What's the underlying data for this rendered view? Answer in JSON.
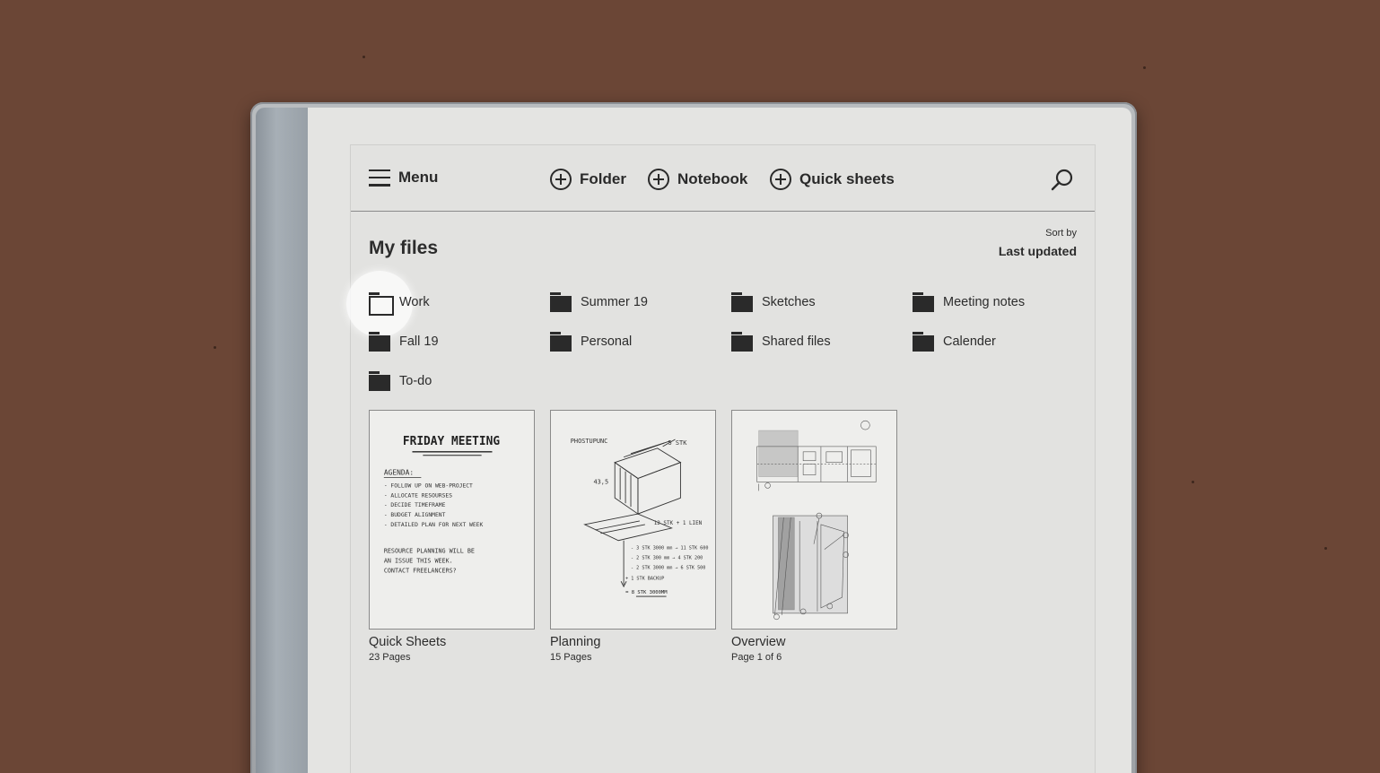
{
  "toolbar": {
    "menu_label": "Menu",
    "folder_label": "Folder",
    "notebook_label": "Notebook",
    "quick_sheets_label": "Quick sheets",
    "search_icon": "search-icon"
  },
  "main": {
    "title": "My files",
    "sort_label": "Sort by",
    "sort_value": "Last updated"
  },
  "folders": [
    {
      "name": "Work",
      "state": "open"
    },
    {
      "name": "Summer 19"
    },
    {
      "name": "Sketches"
    },
    {
      "name": "Meeting notes"
    },
    {
      "name": "Fall 19"
    },
    {
      "name": "Personal"
    },
    {
      "name": "Shared files"
    },
    {
      "name": "Calender"
    },
    {
      "name": "To-do"
    }
  ],
  "files": [
    {
      "name": "Quick Sheets",
      "meta": "23 Pages",
      "note": {
        "heading": "FRIDAY MEETING",
        "agenda": "AGENDA:",
        "lines": [
          "- FOLLOW UP ON WEB-PROJECT",
          "- ALLOCATE RESOURSES",
          "- DECIDE TIMEFRAME",
          "- BUDGET ALIGNMENT",
          "- DETAILED PLAN FOR NEXT WEEK"
        ],
        "footer": [
          "RESOURCE PLANNING WILL BE",
          "AN ISSUE THIS WEEK.",
          "CONTACT FREELANCERS?"
        ]
      }
    },
    {
      "name": "Planning",
      "meta": "15 Pages",
      "sketch": {
        "label_top": "PHOSTUPUNC",
        "dim_a": "5 STK",
        "dim_b": "43,5",
        "dim_c": "12 STK + 1 LIEN",
        "list": [
          "- 3 STK 3000 mm → 11 STK 600",
          "- 2 STK 300 mm → 4 STK 200",
          "- 2 STK 3000 mm → 6 STK 500",
          "+ 1 STK BACKUP"
        ],
        "total": "= 8 STK 3000MM"
      }
    },
    {
      "name": "Overview",
      "meta": "Page 1 of 6"
    }
  ]
}
